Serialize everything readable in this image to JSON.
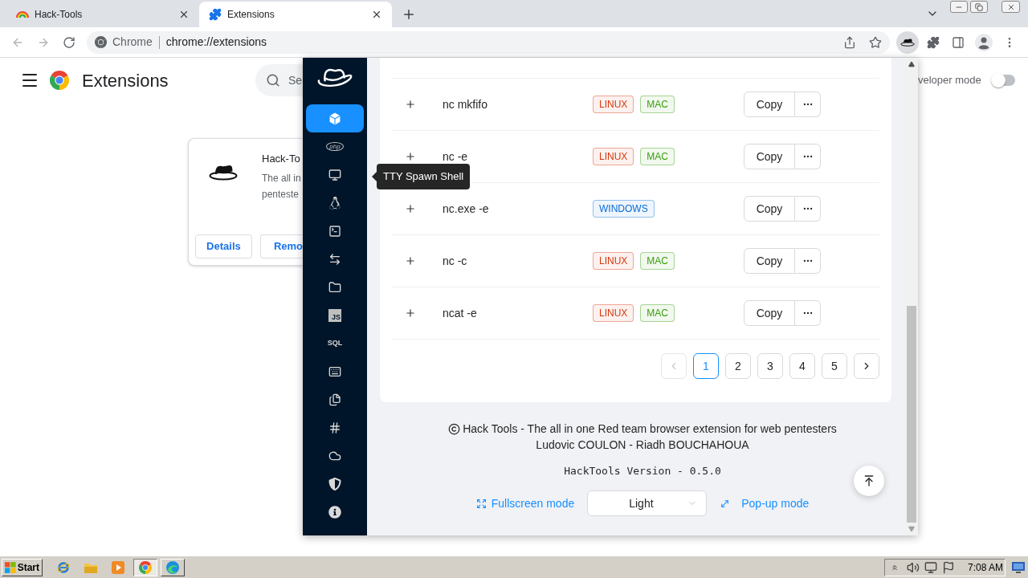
{
  "browser": {
    "tabs": [
      {
        "title": "Hack-Tools",
        "selected": false
      },
      {
        "title": "Extensions",
        "selected": true
      }
    ],
    "omnibox": {
      "chip": "Chrome",
      "url": "chrome://extensions"
    },
    "extension_button": {
      "active": true
    }
  },
  "extensions_page": {
    "title": "Extensions",
    "search": {
      "placeholder": "Se"
    },
    "card": {
      "name": "Hack-To",
      "description": [
        "The all in",
        "penteste"
      ],
      "buttons": [
        "Details",
        "Remo"
      ]
    },
    "developer_mode": {
      "label": "veloper mode",
      "on": false
    }
  },
  "popup": {
    "sidebar": {
      "items": [
        {
          "kind": "icon",
          "selected": true
        },
        {
          "kind": "oval",
          "label": "php",
          "selected": false
        },
        {
          "kind": "icon",
          "selected": false
        },
        {
          "kind": "icon",
          "selected": false
        },
        {
          "kind": "icon",
          "selected": false
        },
        {
          "kind": "icon",
          "selected": false
        },
        {
          "kind": "icon",
          "selected": false
        },
        {
          "kind": "tile",
          "label": "JS",
          "selected": false
        },
        {
          "kind": "text",
          "label": "SQL",
          "selected": false
        },
        {
          "kind": "icon",
          "selected": false
        },
        {
          "kind": "icon",
          "selected": false
        },
        {
          "kind": "icon",
          "selected": false
        },
        {
          "kind": "icon",
          "selected": false
        },
        {
          "kind": "icon",
          "selected": false
        },
        {
          "kind": "icon",
          "selected": false
        }
      ]
    },
    "tooltip": "TTY Spawn Shell",
    "table": {
      "rows": [
        {
          "name": "nc mkfifo",
          "tags": [
            {
              "label": "LINUX",
              "color": "#d4380d"
            },
            {
              "label": "MAC",
              "color": "#389e0d"
            }
          ],
          "action": "Copy"
        },
        {
          "name": "nc -e",
          "tags": [
            {
              "label": "LINUX",
              "color": "#d4380d"
            },
            {
              "label": "MAC",
              "color": "#389e0d"
            }
          ],
          "action": "Copy"
        },
        {
          "name": "nc.exe -e",
          "tags": [
            {
              "label": "WINDOWS",
              "color": "#096dd9"
            }
          ],
          "action": "Copy"
        },
        {
          "name": "nc -c",
          "tags": [
            {
              "label": "LINUX",
              "color": "#d4380d"
            },
            {
              "label": "MAC",
              "color": "#389e0d"
            }
          ],
          "action": "Copy"
        },
        {
          "name": "ncat -e",
          "tags": [
            {
              "label": "LINUX",
              "color": "#d4380d"
            },
            {
              "label": "MAC",
              "color": "#389e0d"
            }
          ],
          "action": "Copy"
        }
      ]
    },
    "pagination": {
      "previous": {
        "disabled": true
      },
      "pages": [
        {
          "label": "1",
          "selected": true
        },
        {
          "label": "2",
          "selected": false
        },
        {
          "label": "3",
          "selected": false
        },
        {
          "label": "4",
          "selected": false
        },
        {
          "label": "5",
          "selected": false
        }
      ],
      "next": {
        "disabled": false
      }
    },
    "footer": {
      "credit": "Hack Tools - The all in one Red team browser extension for web pentesters",
      "authors": "Ludovic COULON - Riadh BOUCHAHOUA",
      "version": "HackTools Version - 0.5.0",
      "fullscreen_link": "Fullscreen mode",
      "theme_select": {
        "value": "Light"
      },
      "popup_link": "Pop-up mode"
    }
  },
  "taskbar": {
    "start": "Start",
    "tasks": [
      {
        "selected": true
      },
      {
        "selected": false
      }
    ],
    "clock": "7:08 AM"
  }
}
